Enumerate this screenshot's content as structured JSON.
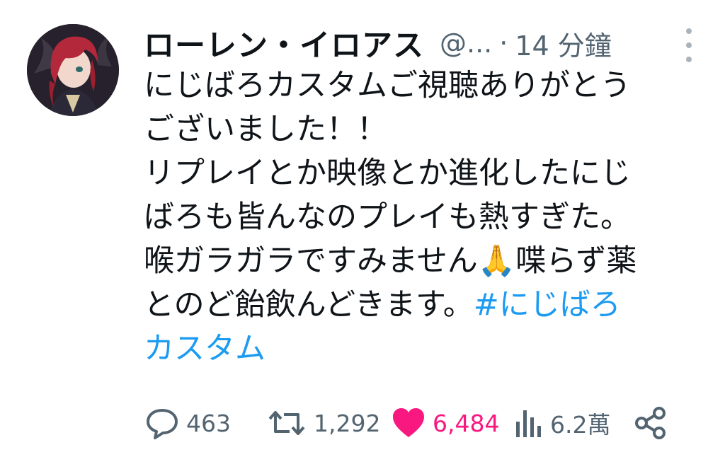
{
  "tweet": {
    "display_name": "ローレン・イロアス",
    "handle": "@...",
    "separator": "·",
    "time": "14 分鐘",
    "text_lines": [
      "にじばろカスタムご視聴ありがとう",
      "ございました！！",
      "リプレイとか映像とか進化したにじ",
      "ばろも皆んなのプレイも熱すぎた。",
      "喉ガラガラですみません🙏喋らず薬",
      "とのど飴飲んどきます。"
    ],
    "hashtag_part1": "#にじばろ",
    "hashtag_part2": "カスタム"
  },
  "actions": {
    "reply_count": "463",
    "retweet_count": "1,292",
    "like_count": "6,484",
    "views_count": "6.2萬"
  },
  "icons": {
    "reply": "speech-bubble-icon",
    "retweet": "retweet-icon",
    "like": "heart-icon",
    "views": "bar-chart-icon",
    "share": "share-icon",
    "more": "more-vertical-icon"
  },
  "colors": {
    "text": "#0f1419",
    "muted": "#536471",
    "hashtag": "#1d9bf0",
    "like": "#f91880"
  }
}
